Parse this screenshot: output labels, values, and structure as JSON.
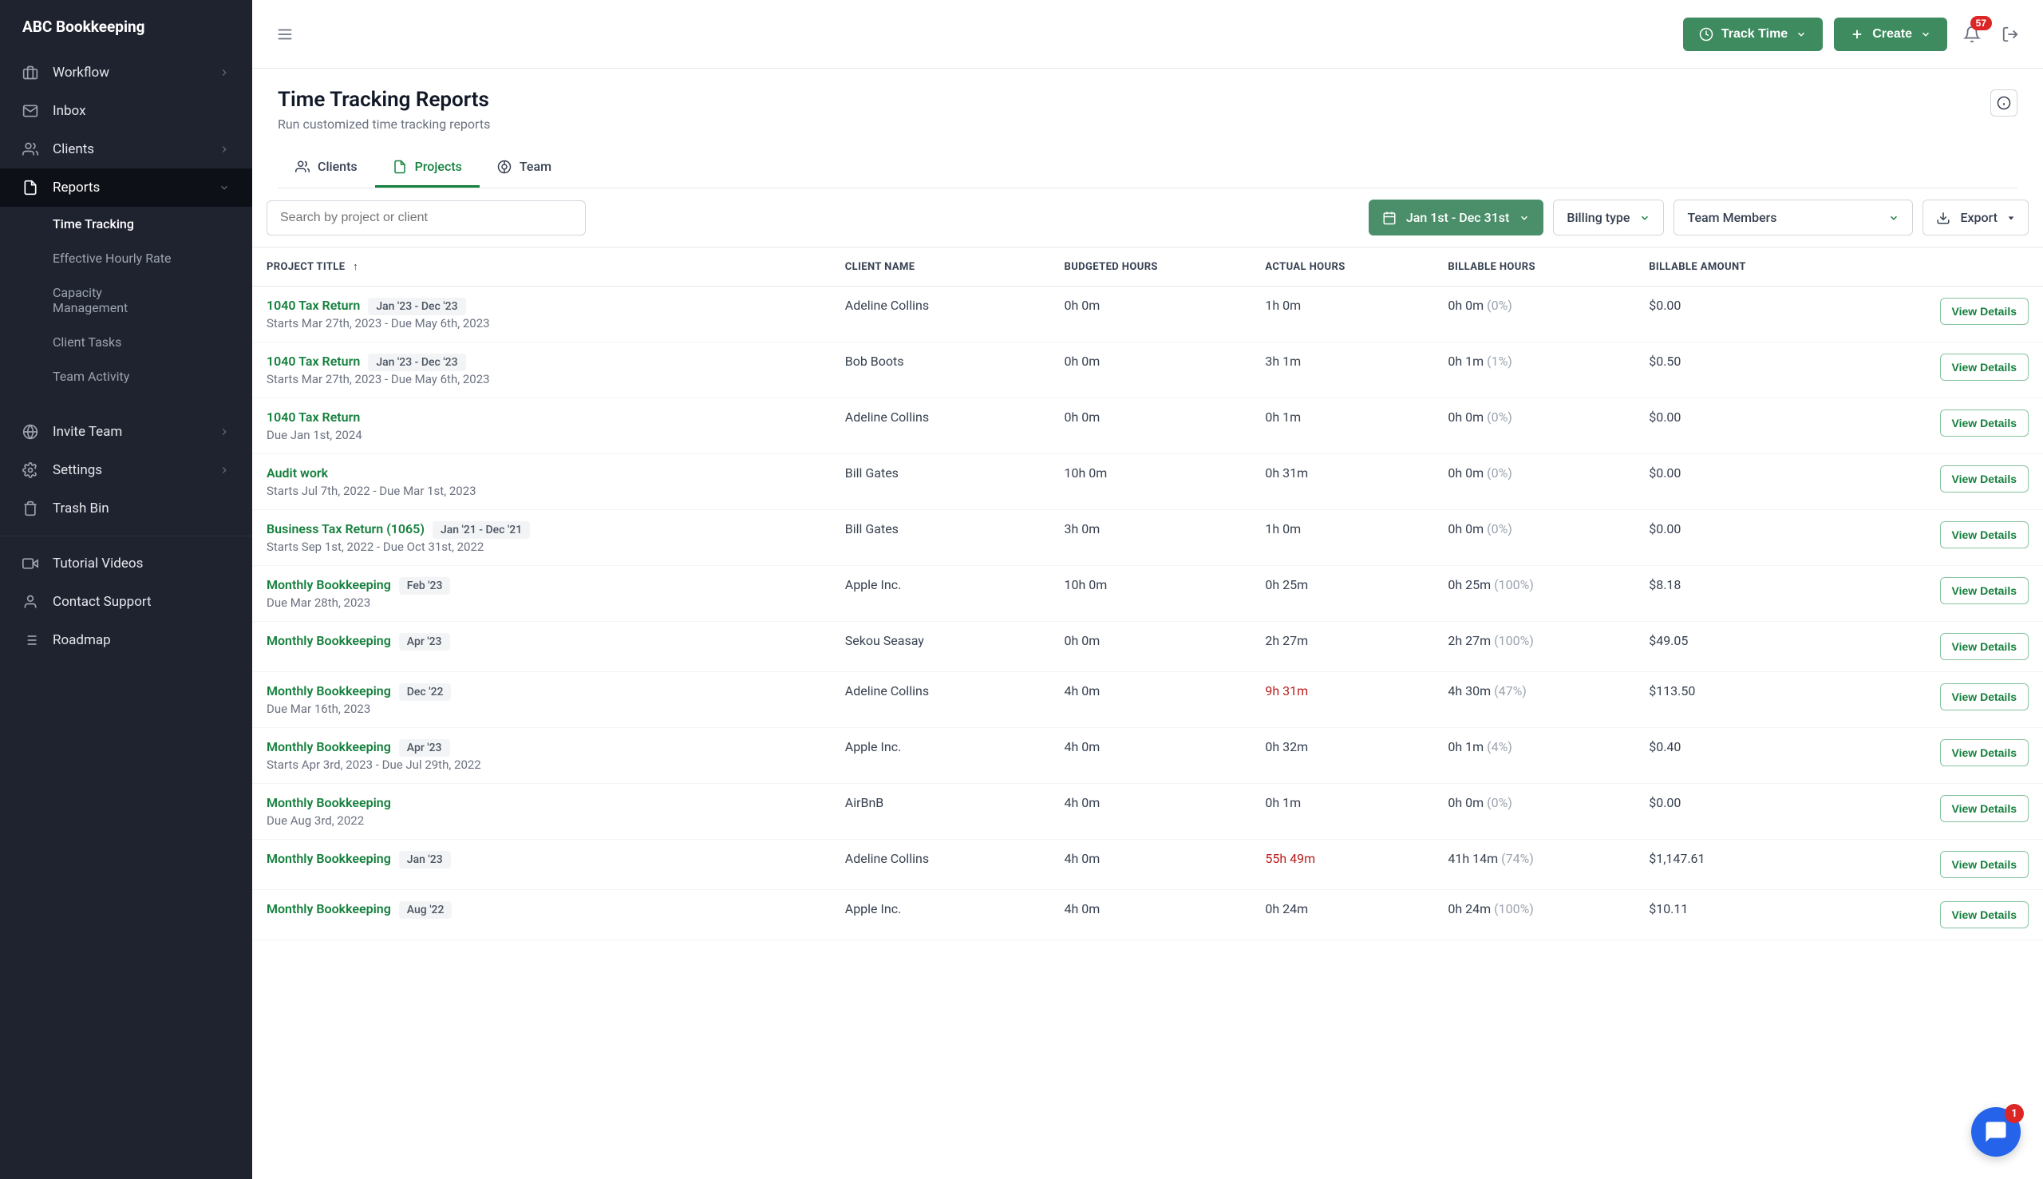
{
  "brand": "ABC Bookkeeping",
  "sidebar": {
    "workflow": "Workflow",
    "inbox": "Inbox",
    "clients": "Clients",
    "reports": "Reports",
    "sub": {
      "timeTracking": "Time Tracking",
      "effectiveHourly": "Effective Hourly Rate",
      "capacityMgmt": "Capacity Management",
      "clientTasks": "Client Tasks",
      "teamActivity": "Team Activity"
    },
    "inviteTeam": "Invite Team",
    "settings": "Settings",
    "trashBin": "Trash Bin",
    "tutorialVideos": "Tutorial Videos",
    "contactSupport": "Contact Support",
    "roadmap": "Roadmap"
  },
  "topbar": {
    "trackTime": "Track Time",
    "create": "Create",
    "notifCount": "57"
  },
  "page": {
    "title": "Time Tracking Reports",
    "subtitle": "Run customized time tracking reports"
  },
  "tabs": {
    "clients": "Clients",
    "projects": "Projects",
    "team": "Team"
  },
  "filters": {
    "searchPlaceholder": "Search by project or client",
    "dateRange": "Jan 1st - Dec 31st",
    "billingType": "Billing type",
    "teamMembers": "Team Members",
    "export": "Export"
  },
  "table": {
    "headers": {
      "projectTitle": "PROJECT TITLE",
      "clientName": "CLIENT NAME",
      "budgeted": "BUDGETED HOURS",
      "actual": "ACTUAL HOURS",
      "billable": "BILLABLE HOURS",
      "amount": "BILLABLE AMOUNT"
    }
  },
  "rows": [
    {
      "title": "1040 Tax Return",
      "badge": "Jan '23 - Dec '23",
      "sub": "Starts Mar 27th, 2023 - Due May 6th, 2023",
      "client": "Adeline Collins",
      "budgeted": "0h 0m",
      "actual": "1h 0m",
      "actualOver": false,
      "billable": "0h 0m",
      "billablePct": "(0%)",
      "amount": "$0.00",
      "view": "View Details"
    },
    {
      "title": "1040 Tax Return",
      "badge": "Jan '23 - Dec '23",
      "sub": "Starts Mar 27th, 2023 - Due May 6th, 2023",
      "client": "Bob Boots",
      "budgeted": "0h 0m",
      "actual": "3h 1m",
      "actualOver": false,
      "billable": "0h 1m",
      "billablePct": "(1%)",
      "amount": "$0.50",
      "view": "View Details"
    },
    {
      "title": "1040 Tax Return",
      "badge": "",
      "sub": "Due Jan 1st, 2024",
      "client": "Adeline Collins",
      "budgeted": "0h 0m",
      "actual": "0h 1m",
      "actualOver": false,
      "billable": "0h 0m",
      "billablePct": "(0%)",
      "amount": "$0.00",
      "view": "View Details"
    },
    {
      "title": "Audit work",
      "badge": "",
      "sub": "Starts Jul 7th, 2022 - Due Mar 1st, 2023",
      "client": "Bill Gates",
      "budgeted": "10h 0m",
      "actual": "0h 31m",
      "actualOver": false,
      "billable": "0h 0m",
      "billablePct": "(0%)",
      "amount": "$0.00",
      "view": "View Details"
    },
    {
      "title": "Business Tax Return (1065)",
      "badge": "Jan '21 - Dec '21",
      "sub": "Starts Sep 1st, 2022 - Due Oct 31st, 2022",
      "client": "Bill Gates",
      "budgeted": "3h 0m",
      "actual": "1h 0m",
      "actualOver": false,
      "billable": "0h 0m",
      "billablePct": "(0%)",
      "amount": "$0.00",
      "view": "View Details"
    },
    {
      "title": "Monthly Bookkeeping",
      "badge": "Feb '23",
      "sub": "Due Mar 28th, 2023",
      "client": "Apple Inc.",
      "budgeted": "10h 0m",
      "actual": "0h 25m",
      "actualOver": false,
      "billable": "0h 25m",
      "billablePct": "(100%)",
      "amount": "$8.18",
      "view": "View Details"
    },
    {
      "title": "Monthly Bookkeeping",
      "badge": "Apr '23",
      "sub": "",
      "client": "Sekou Seasay",
      "budgeted": "0h 0m",
      "actual": "2h 27m",
      "actualOver": false,
      "billable": "2h 27m",
      "billablePct": "(100%)",
      "amount": "$49.05",
      "view": "View Details"
    },
    {
      "title": "Monthly Bookkeeping",
      "badge": "Dec '22",
      "sub": "Due Mar 16th, 2023",
      "client": "Adeline Collins",
      "budgeted": "4h 0m",
      "actual": "9h 31m",
      "actualOver": true,
      "billable": "4h 30m",
      "billablePct": "(47%)",
      "amount": "$113.50",
      "view": "View Details"
    },
    {
      "title": "Monthly Bookkeeping",
      "badge": "Apr '23",
      "sub": "Starts Apr 3rd, 2023 - Due Jul 29th, 2022",
      "client": "Apple Inc.",
      "budgeted": "4h 0m",
      "actual": "0h 32m",
      "actualOver": false,
      "billable": "0h 1m",
      "billablePct": "(4%)",
      "amount": "$0.40",
      "view": "View Details"
    },
    {
      "title": "Monthly Bookkeeping",
      "badge": "",
      "sub": "Due Aug 3rd, 2022",
      "client": "AirBnB",
      "budgeted": "4h 0m",
      "actual": "0h 1m",
      "actualOver": false,
      "billable": "0h 0m",
      "billablePct": "(0%)",
      "amount": "$0.00",
      "view": "View Details"
    },
    {
      "title": "Monthly Bookkeeping",
      "badge": "Jan '23",
      "sub": "",
      "client": "Adeline Collins",
      "budgeted": "4h 0m",
      "actual": "55h 49m",
      "actualOver": true,
      "billable": "41h 14m",
      "billablePct": "(74%)",
      "amount": "$1,147.61",
      "view": "View Details"
    },
    {
      "title": "Monthly Bookkeeping",
      "badge": "Aug '22",
      "sub": "",
      "client": "Apple Inc.",
      "budgeted": "4h 0m",
      "actual": "0h 24m",
      "actualOver": false,
      "billable": "0h 24m",
      "billablePct": "(100%)",
      "amount": "$10.11",
      "view": "View Details"
    }
  ],
  "chatBadge": "1"
}
